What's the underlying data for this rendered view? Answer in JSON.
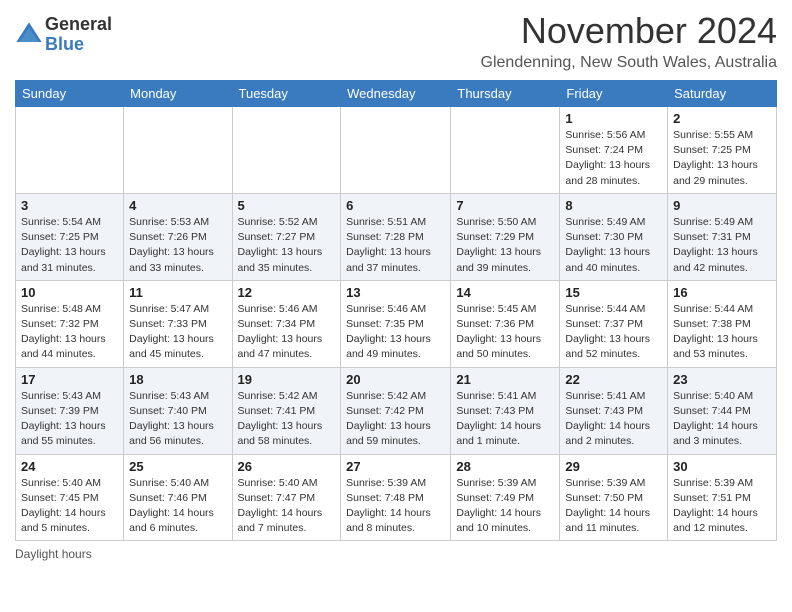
{
  "logo": {
    "general": "General",
    "blue": "Blue"
  },
  "title": "November 2024",
  "location": "Glendenning, New South Wales, Australia",
  "weekdays": [
    "Sunday",
    "Monday",
    "Tuesday",
    "Wednesday",
    "Thursday",
    "Friday",
    "Saturday"
  ],
  "footer": "Daylight hours",
  "weeks": [
    [
      {
        "day": "",
        "info": ""
      },
      {
        "day": "",
        "info": ""
      },
      {
        "day": "",
        "info": ""
      },
      {
        "day": "",
        "info": ""
      },
      {
        "day": "",
        "info": ""
      },
      {
        "day": "1",
        "info": "Sunrise: 5:56 AM\nSunset: 7:24 PM\nDaylight: 13 hours\nand 28 minutes."
      },
      {
        "day": "2",
        "info": "Sunrise: 5:55 AM\nSunset: 7:25 PM\nDaylight: 13 hours\nand 29 minutes."
      }
    ],
    [
      {
        "day": "3",
        "info": "Sunrise: 5:54 AM\nSunset: 7:25 PM\nDaylight: 13 hours\nand 31 minutes."
      },
      {
        "day": "4",
        "info": "Sunrise: 5:53 AM\nSunset: 7:26 PM\nDaylight: 13 hours\nand 33 minutes."
      },
      {
        "day": "5",
        "info": "Sunrise: 5:52 AM\nSunset: 7:27 PM\nDaylight: 13 hours\nand 35 minutes."
      },
      {
        "day": "6",
        "info": "Sunrise: 5:51 AM\nSunset: 7:28 PM\nDaylight: 13 hours\nand 37 minutes."
      },
      {
        "day": "7",
        "info": "Sunrise: 5:50 AM\nSunset: 7:29 PM\nDaylight: 13 hours\nand 39 minutes."
      },
      {
        "day": "8",
        "info": "Sunrise: 5:49 AM\nSunset: 7:30 PM\nDaylight: 13 hours\nand 40 minutes."
      },
      {
        "day": "9",
        "info": "Sunrise: 5:49 AM\nSunset: 7:31 PM\nDaylight: 13 hours\nand 42 minutes."
      }
    ],
    [
      {
        "day": "10",
        "info": "Sunrise: 5:48 AM\nSunset: 7:32 PM\nDaylight: 13 hours\nand 44 minutes."
      },
      {
        "day": "11",
        "info": "Sunrise: 5:47 AM\nSunset: 7:33 PM\nDaylight: 13 hours\nand 45 minutes."
      },
      {
        "day": "12",
        "info": "Sunrise: 5:46 AM\nSunset: 7:34 PM\nDaylight: 13 hours\nand 47 minutes."
      },
      {
        "day": "13",
        "info": "Sunrise: 5:46 AM\nSunset: 7:35 PM\nDaylight: 13 hours\nand 49 minutes."
      },
      {
        "day": "14",
        "info": "Sunrise: 5:45 AM\nSunset: 7:36 PM\nDaylight: 13 hours\nand 50 minutes."
      },
      {
        "day": "15",
        "info": "Sunrise: 5:44 AM\nSunset: 7:37 PM\nDaylight: 13 hours\nand 52 minutes."
      },
      {
        "day": "16",
        "info": "Sunrise: 5:44 AM\nSunset: 7:38 PM\nDaylight: 13 hours\nand 53 minutes."
      }
    ],
    [
      {
        "day": "17",
        "info": "Sunrise: 5:43 AM\nSunset: 7:39 PM\nDaylight: 13 hours\nand 55 minutes."
      },
      {
        "day": "18",
        "info": "Sunrise: 5:43 AM\nSunset: 7:40 PM\nDaylight: 13 hours\nand 56 minutes."
      },
      {
        "day": "19",
        "info": "Sunrise: 5:42 AM\nSunset: 7:41 PM\nDaylight: 13 hours\nand 58 minutes."
      },
      {
        "day": "20",
        "info": "Sunrise: 5:42 AM\nSunset: 7:42 PM\nDaylight: 13 hours\nand 59 minutes."
      },
      {
        "day": "21",
        "info": "Sunrise: 5:41 AM\nSunset: 7:43 PM\nDaylight: 14 hours\nand 1 minute."
      },
      {
        "day": "22",
        "info": "Sunrise: 5:41 AM\nSunset: 7:43 PM\nDaylight: 14 hours\nand 2 minutes."
      },
      {
        "day": "23",
        "info": "Sunrise: 5:40 AM\nSunset: 7:44 PM\nDaylight: 14 hours\nand 3 minutes."
      }
    ],
    [
      {
        "day": "24",
        "info": "Sunrise: 5:40 AM\nSunset: 7:45 PM\nDaylight: 14 hours\nand 5 minutes."
      },
      {
        "day": "25",
        "info": "Sunrise: 5:40 AM\nSunset: 7:46 PM\nDaylight: 14 hours\nand 6 minutes."
      },
      {
        "day": "26",
        "info": "Sunrise: 5:40 AM\nSunset: 7:47 PM\nDaylight: 14 hours\nand 7 minutes."
      },
      {
        "day": "27",
        "info": "Sunrise: 5:39 AM\nSunset: 7:48 PM\nDaylight: 14 hours\nand 8 minutes."
      },
      {
        "day": "28",
        "info": "Sunrise: 5:39 AM\nSunset: 7:49 PM\nDaylight: 14 hours\nand 10 minutes."
      },
      {
        "day": "29",
        "info": "Sunrise: 5:39 AM\nSunset: 7:50 PM\nDaylight: 14 hours\nand 11 minutes."
      },
      {
        "day": "30",
        "info": "Sunrise: 5:39 AM\nSunset: 7:51 PM\nDaylight: 14 hours\nand 12 minutes."
      }
    ]
  ]
}
